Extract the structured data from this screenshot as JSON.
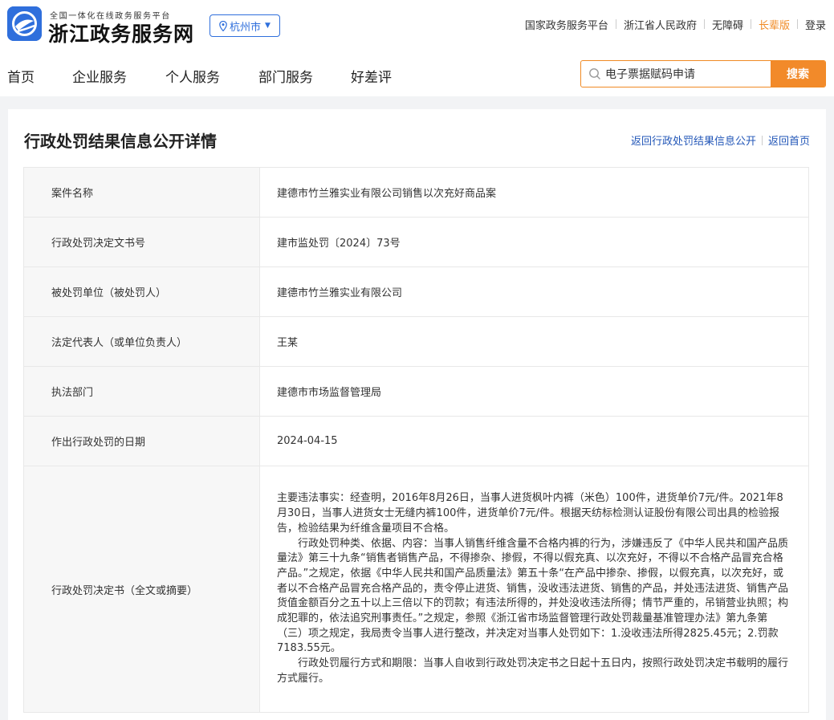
{
  "header": {
    "brand_sub": "全国一体化在线政务服务平台",
    "brand_name": "浙江政务服务网",
    "city": "杭州市",
    "links": [
      "国家政务服务平台",
      "浙江省人民政府",
      "无障碍",
      "长辈版",
      "登录"
    ]
  },
  "nav": {
    "items": [
      "首页",
      "企业服务",
      "个人服务",
      "部门服务",
      "好差评"
    ],
    "search_value": "电子票据赋码申请",
    "search_button": "搜索"
  },
  "page": {
    "title": "行政处罚结果信息公开详情",
    "back_list": "返回行政处罚结果信息公开",
    "back_home": "返回首页"
  },
  "details": [
    {
      "label": "案件名称",
      "value": "建德市竹兰雅实业有限公司销售以次充好商品案"
    },
    {
      "label": "行政处罚决定文书号",
      "value": "建市监处罚〔2024〕73号"
    },
    {
      "label": "被处罚单位（被处罚人）",
      "value": "建德市竹兰雅实业有限公司"
    },
    {
      "label": "法定代表人（或单位负责人）",
      "value": "王某"
    },
    {
      "label": "执法部门",
      "value": "建德市市场监督管理局"
    },
    {
      "label": "作出行政处罚的日期",
      "value": "2024-04-15"
    }
  ],
  "decision": {
    "label": "行政处罚决定书（全文或摘要）",
    "paragraphs": [
      "主要违法事实：经查明，2016年8月26日，当事人进货枫叶内裤（米色）100件，进货单价7元/件。2021年8月30日，当事人进货女士无缝内裤100件，进货单价7元/件。根据天纺标检测认证股份有限公司出具的检验报告，检验结果为纤维含量项目不合格。",
      "行政处罚种类、依据、内容：当事人销售纤维含量不合格内裤的行为，涉嫌违反了《中华人民共和国产品质量法》第三十九条“销售者销售产品，不得掺杂、掺假，不得以假充真、以次充好，不得以不合格产品冒充合格产品。”之规定，依据《中华人民共和国产品质量法》第五十条“在产品中掺杂、掺假，以假充真，以次充好，或者以不合格产品冒充合格产品的，责令停止进货、销售，没收违法进货、销售的产品，并处违法进货、销售产品货值金额百分之五十以上三倍以下的罚款；有违法所得的，并处没收违法所得；情节严重的，吊销营业执照；构成犯罪的，依法追究刑事责任。”之规定，参照《浙江省市场监督管理行政处罚裁量基准管理办法》第九条第（三）项之规定，我局责令当事人进行整改，并决定对当事人处罚如下：1.没收违法所得2825.45元；2.罚款7183.55元。",
      "行政处罚履行方式和期限：当事人自收到行政处罚决定书之日起十五日内，按照行政处罚决定书载明的履行方式履行。"
    ]
  }
}
